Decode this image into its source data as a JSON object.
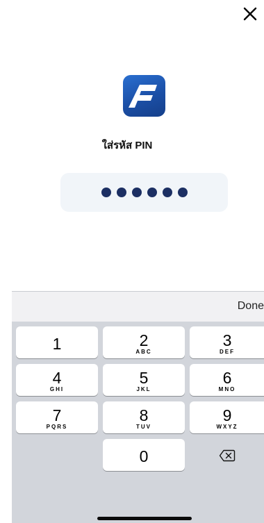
{
  "header": {
    "close_icon": "close-icon"
  },
  "logo": {
    "icon": "app-logo-f",
    "colors": [
      "#2a6fd0",
      "#153f8a"
    ]
  },
  "pin": {
    "title": "ใส่รหัส PIN",
    "digits_entered": 6,
    "dot_color": "#1c2f63"
  },
  "keyboard": {
    "done_label": "Done",
    "keys": [
      {
        "num": "1",
        "letters": ""
      },
      {
        "num": "2",
        "letters": "ABC"
      },
      {
        "num": "3",
        "letters": "DEF"
      },
      {
        "num": "4",
        "letters": "GHI"
      },
      {
        "num": "5",
        "letters": "JKL"
      },
      {
        "num": "6",
        "letters": "MNO"
      },
      {
        "num": "7",
        "letters": "PQRS"
      },
      {
        "num": "8",
        "letters": "TUV"
      },
      {
        "num": "9",
        "letters": "WXYZ"
      },
      {
        "num": "0",
        "letters": ""
      }
    ],
    "backspace_icon": "backspace-icon"
  }
}
